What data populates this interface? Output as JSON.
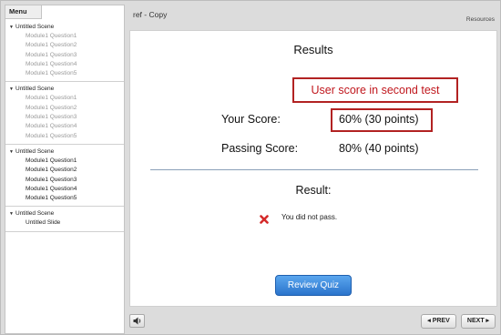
{
  "header": {
    "title": "ref - Copy",
    "resources": "Resources"
  },
  "sidebar": {
    "menu_tab": "Menu",
    "scenes": [
      {
        "name": "Untitled Scene",
        "style": "gray",
        "slides": [
          "Module1 Question1",
          "Module1 Question2",
          "Module1 Question3",
          "Module1 Question4",
          "Module1 Question5"
        ]
      },
      {
        "name": "Untitled Scene",
        "style": "gray",
        "slides": [
          "Module1 Question1",
          "Module1 Question2",
          "Module1 Question3",
          "Module1 Question4",
          "Module1 Question5"
        ]
      },
      {
        "name": "Untitled Scene",
        "style": "dark",
        "slides": [
          "Module1 Question1",
          "Module1 Question2",
          "Module1 Question3",
          "Module1 Question4",
          "Module1 Question5"
        ]
      },
      {
        "name": "Untitled Scene",
        "style": "dark",
        "slides": [
          "Untitled Slide"
        ]
      }
    ]
  },
  "results": {
    "title": "Results",
    "annotation": "User score in second test",
    "your_score_label": "Your Score:",
    "your_score_value": "60% (30 points)",
    "passing_score_label": "Passing Score:",
    "passing_score_value": "80% (40 points)",
    "result_label": "Result:",
    "result_message": "You did not pass.",
    "review_button": "Review Quiz"
  },
  "controls": {
    "prev": "◂ PREV",
    "next": "NEXT ▸"
  },
  "icons": {
    "fail": "x-mark-icon",
    "audio": "speaker-icon",
    "scene_toggle": "triangle-down-icon"
  },
  "colors": {
    "annotation": "#c0171d",
    "fail_icon": "#d42a2a",
    "review_button": "#3b86d9"
  }
}
